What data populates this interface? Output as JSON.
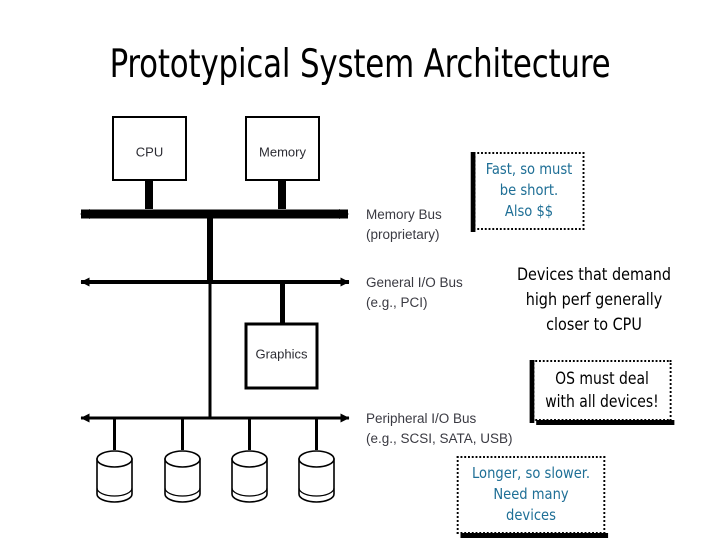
{
  "slide": {
    "title": "Prototypical System Architecture",
    "background_color": "#ffffff"
  },
  "colors": {
    "accent_teal": "#1f6f96",
    "line_black": "#000000",
    "label_gray": "#3a3a42"
  },
  "diagram": {
    "components": [
      {
        "id": "cpu",
        "label": "CPU"
      },
      {
        "id": "memory",
        "label": "Memory"
      },
      {
        "id": "graphics",
        "label": "Graphics"
      }
    ],
    "buses": [
      {
        "id": "memory-bus",
        "name": "Memory Bus",
        "detail": "(proprietary)",
        "thickness": "thick"
      },
      {
        "id": "general-io-bus",
        "name": "General I/O Bus",
        "detail": "(e.g., PCI)",
        "thickness": "medium"
      },
      {
        "id": "peripheral-io-bus",
        "name": "Peripheral I/O Bus",
        "detail": "(e.g., SCSI, SATA, USB)",
        "thickness": "thin"
      }
    ],
    "disks": [
      {
        "id": "disk-1"
      },
      {
        "id": "disk-2"
      },
      {
        "id": "disk-3"
      },
      {
        "id": "disk-4"
      }
    ]
  },
  "callouts": [
    {
      "id": "memory-bus-note",
      "lines": [
        "Fast, so must",
        "be short.",
        "Also $$"
      ],
      "color": "#1f6f96",
      "bordered": true
    },
    {
      "id": "device-placement-note",
      "lines": [
        "Devices that demand",
        "high perf generally",
        "closer to CPU"
      ],
      "color": "#000000",
      "bordered": false
    },
    {
      "id": "os-note",
      "lines": [
        "OS must deal",
        "with all devices!"
      ],
      "color": "#000000",
      "bordered": true
    },
    {
      "id": "peripheral-bus-note",
      "lines": [
        "Longer, so slower.",
        "Need many",
        "devices"
      ],
      "color": "#1f6f96",
      "bordered": true
    }
  ]
}
